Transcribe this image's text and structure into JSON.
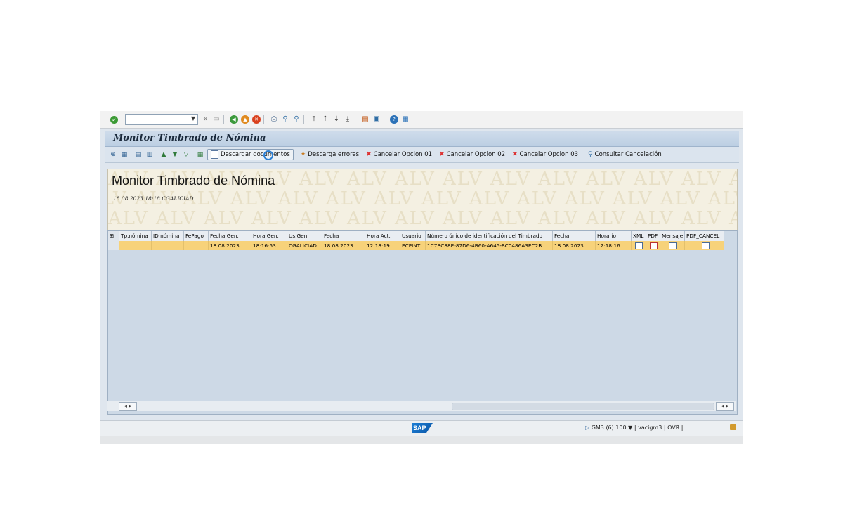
{
  "systoolbar": {
    "command_value": "",
    "icons": [
      "enter-icon",
      "save-icon",
      "back-icon",
      "exit-icon",
      "cancel-icon",
      "print-icon",
      "find-icon",
      "find-next-icon",
      "first-page-icon",
      "prev-page-icon",
      "next-page-icon",
      "last-page-icon",
      "new-session-icon",
      "shortcut-icon",
      "help-icon",
      "customize-icon"
    ]
  },
  "title": "Monitor Timbrado de Nómina",
  "apptoolbar": {
    "download_docs": "Descargar documentos",
    "download_errors": "Descarga errores",
    "cancel_01": "Cancelar Opcion 01",
    "cancel_02": "Cancelar Opcion 02",
    "cancel_03": "Cancelar Opcion 03",
    "consult_cancel": "Consultar Cancelación"
  },
  "header": {
    "title": "Monitor Timbrado de Nómina",
    "subtitle": "18.08.2023 18:18 CGALICIAD .",
    "watermark": "ALV"
  },
  "table": {
    "columns": [
      "Tp.nómina",
      "ID nómina",
      "FePago",
      "Fecha Gen.",
      "Hora.Gen.",
      "Us.Gen.",
      "Fecha",
      "Hora Act.",
      "Usuario",
      "Número único de identificación del Timbrado",
      "Fecha",
      "Horario",
      "XML",
      "PDF",
      "Mensaje",
      "PDF_CANCEL"
    ],
    "rows": [
      {
        "tp_nomina": "",
        "id_nomina": "",
        "fepago": "",
        "fecha_gen": "18.08.2023",
        "hora_gen": "18:16:53",
        "us_gen": "CGALICIAD",
        "fecha": "18.08.2023",
        "hora_act": "12:18:19",
        "usuario": "ECPINT",
        "uuid": "1C7BC88E-87D6-4B60-A645-BC0486A3EC2B",
        "fecha2": "18.08.2023",
        "horario": "12:18:16"
      }
    ]
  },
  "statusbar": {
    "system": "GM3 (6) 100",
    "server": "vacigm3",
    "mode": "OVR"
  },
  "colors": {
    "row_highlight": "#f7d27a",
    "grid_bg": "#cdd9e6",
    "title_bar": "#bccfe3"
  }
}
